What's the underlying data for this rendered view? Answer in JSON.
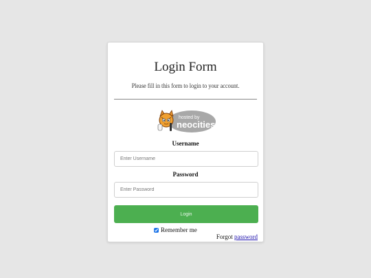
{
  "form": {
    "title": "Login Form",
    "subtitle": "Please fill in this form to login to your account.",
    "badge": {
      "line1": "hosted by",
      "line2": "neocities"
    },
    "username": {
      "label": "Username",
      "placeholder": "Enter Username",
      "value": ""
    },
    "password": {
      "label": "Password",
      "placeholder": "Enter Password",
      "value": ""
    },
    "login_label": "Login",
    "remember": {
      "label": "Remember me",
      "checked": true
    },
    "forgot": {
      "prefix": "Forgot",
      "link": "password"
    }
  },
  "colors": {
    "page_background": "#e6e6e6",
    "button": "#4caf50",
    "link": "#1a0dab"
  },
  "icons": {
    "logo": "neocities-cat-logo"
  }
}
